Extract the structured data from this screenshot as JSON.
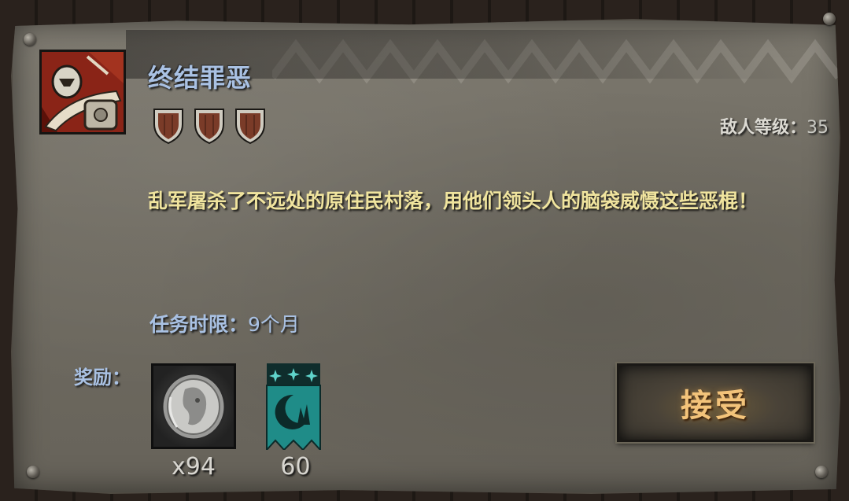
{
  "quest": {
    "title": "终结罪恶",
    "difficulty_shields": 3,
    "enemy_level_label": "敌人等级：",
    "enemy_level_value": "35",
    "description": "乱军屠杀了不远处的原住民村落，用他们领头人的脑袋威慑这些恶棍！",
    "time_limit_label": "任务时限：",
    "time_limit_value": "9个月"
  },
  "rewards": {
    "label": "奖励：",
    "items": [
      {
        "icon": "silver-coin-icon",
        "count": "x94"
      },
      {
        "icon": "moon-banner-icon",
        "count": "60"
      }
    ]
  },
  "actions": {
    "accept_label": "接受"
  },
  "colors": {
    "title_blue": "#a9c1e3",
    "description_yellow": "#f0e49e",
    "button_text": "#f3c37a",
    "banner_teal": "#1f8c88",
    "portrait_red": "#7a1c13"
  }
}
